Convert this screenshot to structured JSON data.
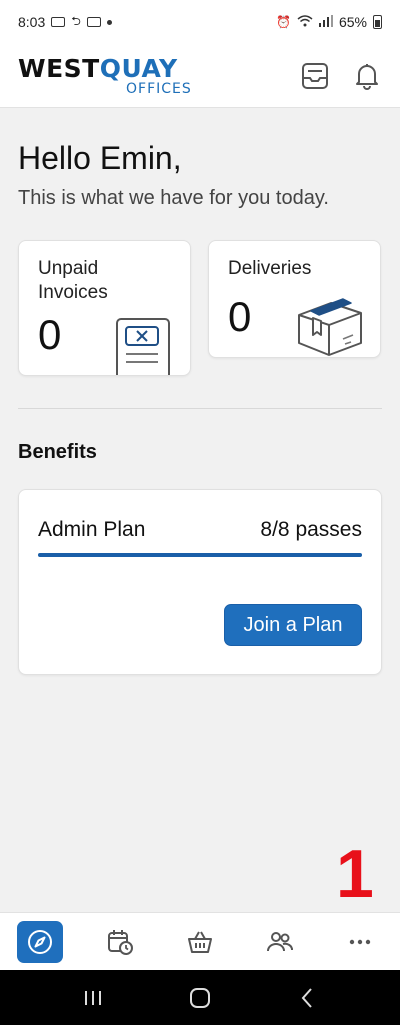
{
  "status_bar": {
    "time": "8:03",
    "battery": "65%"
  },
  "header": {
    "logo_main_left": "WEST",
    "logo_main_q": "Q",
    "logo_main_right": "UAY",
    "logo_sub": "OFFICES",
    "icons": [
      "inbox-icon",
      "bell-icon"
    ]
  },
  "main": {
    "greeting": "Hello Emin,",
    "subtitle": "This is what we have for you today.",
    "stats": [
      {
        "label": "Unpaid Invoices",
        "value": "0",
        "icon": "invoice-icon"
      },
      {
        "label": "Deliveries",
        "value": "0",
        "icon": "package-icon"
      }
    ],
    "benefits": {
      "title": "Benefits",
      "plan": {
        "name": "Admin Plan",
        "passes": "8/8 passes",
        "progress_fraction": 1.0,
        "button_label": "Join a Plan"
      }
    }
  },
  "overlay_number": "1",
  "bottom_nav": {
    "items": [
      "compass-icon",
      "calendar-clock-icon",
      "basket-icon",
      "people-icon",
      "more-icon"
    ],
    "active_index": 0
  },
  "colors": {
    "accent": "#1f6fbd",
    "overlay": "#e8101a"
  }
}
